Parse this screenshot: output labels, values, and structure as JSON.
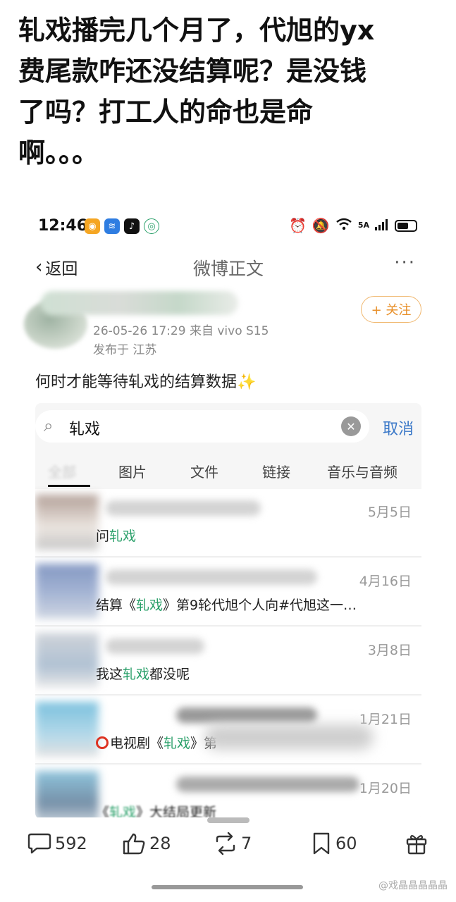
{
  "headline": "轧戏播完几个月了，代旭的yx\n费尾款咋还没结算呢？是没钱\n了吗？打工人的命也是命\n啊。。。",
  "status_bar": {
    "time": "12:46",
    "network": "5A"
  },
  "nav": {
    "back_label": "返回",
    "title": "微博正文",
    "more": "···"
  },
  "post": {
    "timestamp": "26-05-26 17:29  来自 vivo S15",
    "location": "发布于 江苏",
    "follow_label": "+ 关注",
    "text": "何时才能等待轧戏的结算数据"
  },
  "search": {
    "value": "轧戏",
    "cancel_label": "取消"
  },
  "tabs": [
    "全部",
    "图片",
    "文件",
    "链接",
    "音乐与音频"
  ],
  "results": [
    {
      "date": "5月5日",
      "pre": "问",
      "hl": "轧戏",
      "post": ""
    },
    {
      "date": "4月16日",
      "pre": "结算《",
      "hl": "轧戏",
      "post": "》第9轮代旭个人向#代旭这一…"
    },
    {
      "date": "3月8日",
      "pre": "我这",
      "hl": "轧戏",
      "post": "都没呢"
    },
    {
      "date": "1月21日",
      "pre": "电视剧《",
      "hl": "轧戏",
      "post": "》第"
    },
    {
      "date": "1月20日",
      "pre": "《",
      "hl": "轧戏",
      "post": "》大结局更新"
    }
  ],
  "toolbar": {
    "comments": "592",
    "likes": "28",
    "reposts": "7",
    "favorites": "60"
  },
  "watermark": "@戏晶晶晶晶晶"
}
